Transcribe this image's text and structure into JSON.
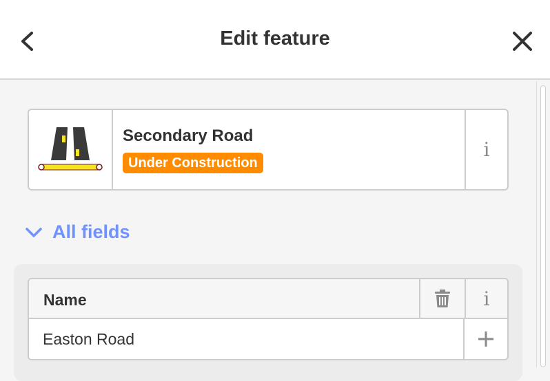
{
  "header": {
    "title": "Edit feature",
    "back_icon": "chevron-left-icon",
    "close_icon": "close-icon"
  },
  "preset": {
    "name": "Secondary Road",
    "badge": "Under Construction",
    "icon": "road-icon",
    "info_label": "i",
    "badge_color": "#ff8c00"
  },
  "fields_section": {
    "toggle_label": "All fields",
    "toggle_icon": "chevron-down-icon",
    "accent_color": "#7092ff"
  },
  "fields": [
    {
      "label": "Name",
      "value": "Easton Road",
      "info_label": "i",
      "delete_icon": "trash-icon",
      "add_icon": "plus-icon"
    }
  ]
}
